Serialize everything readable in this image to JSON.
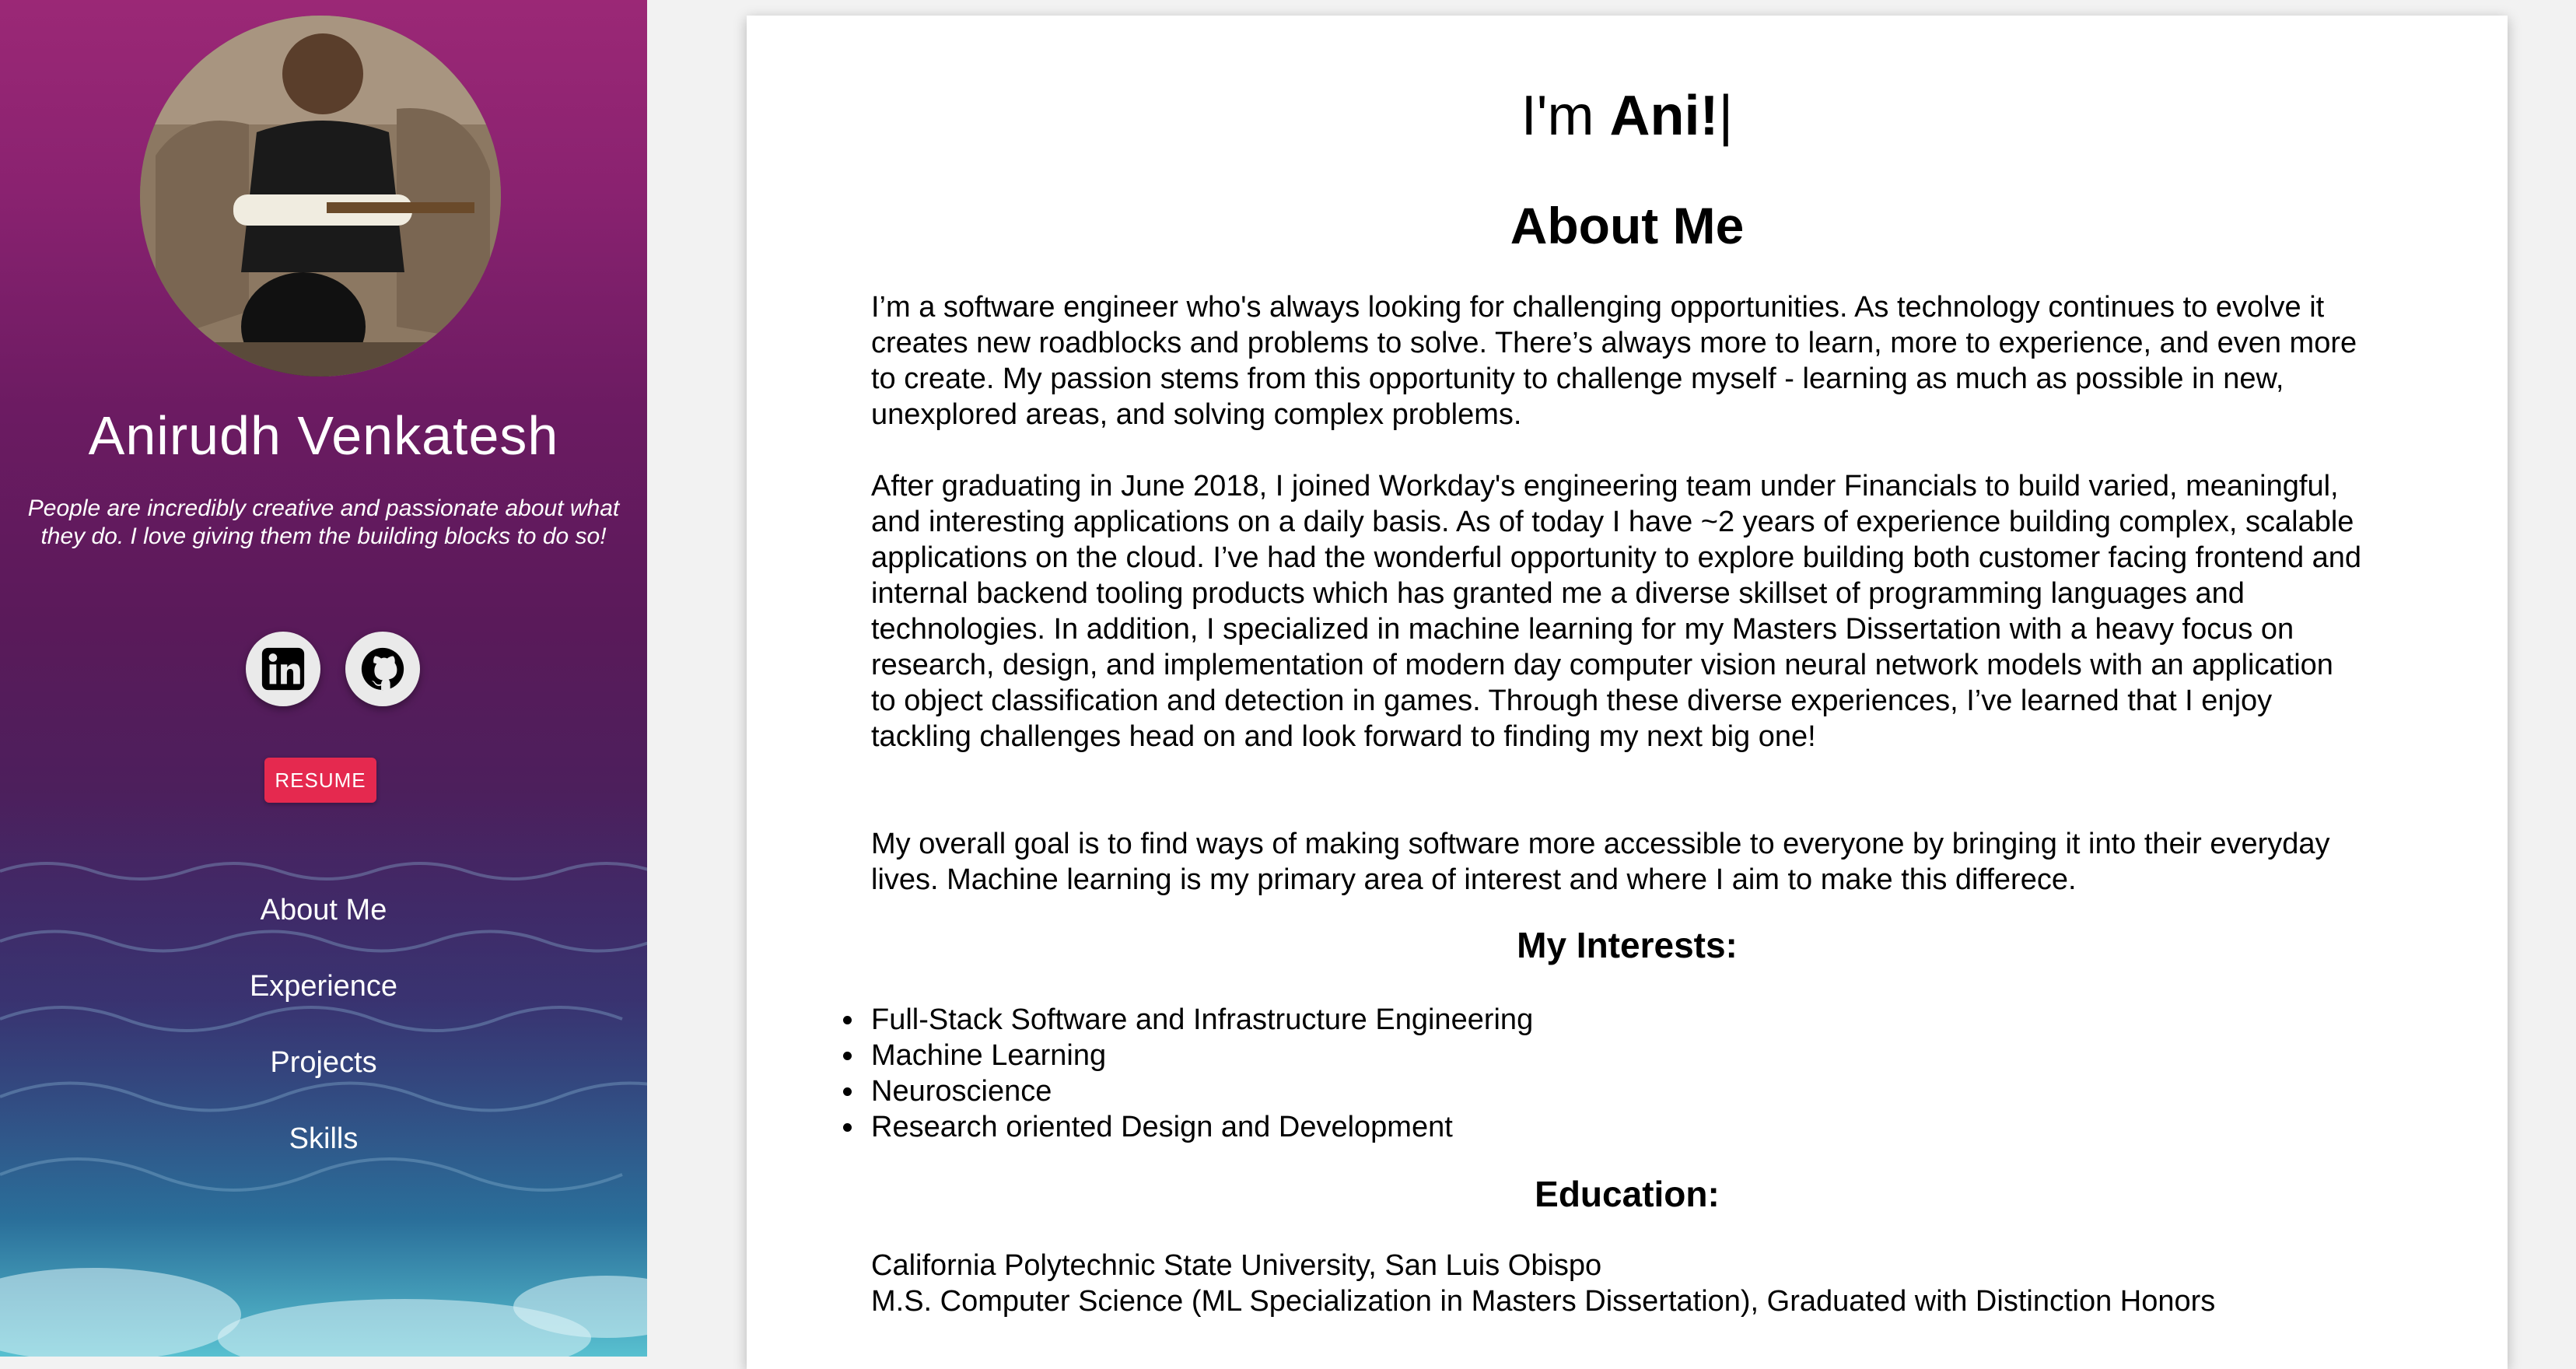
{
  "sidebar": {
    "name": "Anirudh Venkatesh",
    "tagline": "People are incredibly creative and passionate about what they do. I love giving them the building blocks to do so!",
    "social": [
      {
        "icon": "linkedin-icon"
      },
      {
        "icon": "github-icon"
      }
    ],
    "resume_label": "RESUME",
    "nav": [
      {
        "label": "About Me"
      },
      {
        "label": "Experience"
      },
      {
        "label": "Projects"
      },
      {
        "label": "Skills"
      }
    ],
    "accent_color": "#e5294f"
  },
  "main": {
    "greeting_prefix": "I'm ",
    "greeting_name": "Ani!",
    "greeting_cursor": "|",
    "about_title": "About Me",
    "paragraphs": [
      "I’m a software engineer who's always looking for challenging opportunities. As technology continues to evolve it creates new roadblocks and problems to solve. There’s always more to learn, more to experience, and even more to create. My passion stems from this opportunity to challenge myself - learning as much as possible in new, unexplored areas, and solving complex problems.",
      "After graduating in June 2018, I joined Workday's engineering team under Financials to build varied, meaningful, and interesting applications on a daily basis. As of today I have ~2 years of experience building complex, scalable applications on the cloud. I’ve had the wonderful opportunity to explore building both customer facing frontend and internal backend tooling products which has granted me a diverse skillset of programming languages and technologies. In addition, I specialized in machine learning for my Masters Dissertation with a heavy focus on research, design, and implementation of modern day computer vision neural network models with an application to object classification and detection in games. Through these diverse experiences, I’ve learned that I enjoy tackling challenges head on and look forward to finding my next big one!",
      "My overall goal is to find ways of making software more accessible to everyone by bringing it into their everyday lives. Machine learning is my primary area of interest and where I aim to make this differece."
    ],
    "interests_title": "My Interests:",
    "interests": [
      "Full-Stack Software and Infrastructure Engineering",
      "Machine Learning",
      "Neuroscience",
      "Research oriented Design and Development"
    ],
    "education_title": "Education:",
    "education": [
      "California Polytechnic State University, San Luis Obispo",
      "M.S. Computer Science (ML Specialization in Masters Dissertation), Graduated with Distinction Honors"
    ]
  }
}
